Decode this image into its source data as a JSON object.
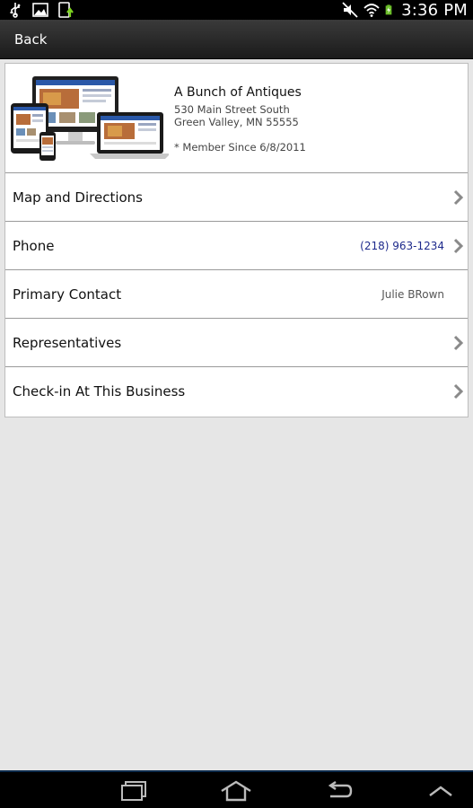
{
  "status_bar": {
    "time": "3:36 PM",
    "icons_left": [
      "usb-icon",
      "gallery-icon",
      "download-icon"
    ],
    "icons_right": [
      "mute-icon",
      "wifi-icon",
      "battery-charging-icon"
    ]
  },
  "action_bar": {
    "back_label": "Back"
  },
  "business": {
    "name": "A Bunch of Antiques",
    "address_line1": "530 Main Street South",
    "address_line2": "Green Valley, MN  55555",
    "member_since": "* Member Since 6/8/2011",
    "thumbnail_icon": "website-devices-thumbnail"
  },
  "rows": [
    {
      "label": "Map and Directions",
      "value": "",
      "chevron": true
    },
    {
      "label": "Phone",
      "value": "(218) 963-1234",
      "chevron": true
    },
    {
      "label": "Primary Contact",
      "value": "Julie BRown",
      "chevron": false
    },
    {
      "label": "Representatives",
      "value": "",
      "chevron": true
    },
    {
      "label": "Check-in At This Business",
      "value": "",
      "chevron": true
    }
  ],
  "colors": {
    "phone_link": "#1e2a8c",
    "background": "#e6e6e6",
    "action_bar": "#2b2b2b"
  },
  "nav_bar": {
    "icons": [
      "recent-apps-icon",
      "home-icon",
      "back-icon",
      "menu-up-icon"
    ]
  }
}
